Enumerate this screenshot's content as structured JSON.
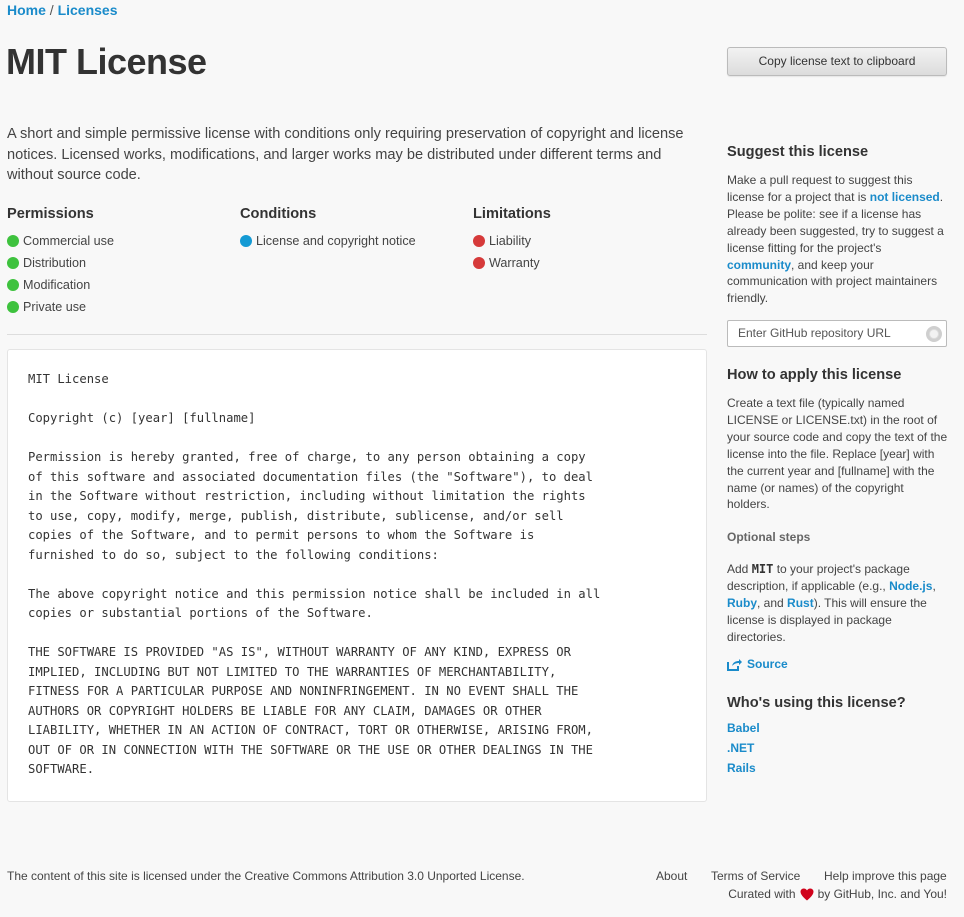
{
  "breadcrumb": {
    "home": "Home",
    "sep": "/",
    "licenses": "Licenses"
  },
  "page": {
    "title": "MIT License",
    "copy_button": "Copy license text to clipboard",
    "description": "A short and simple permissive license with conditions only requiring preservation of copyright and license notices. Licensed works, modifications, and larger works may be distributed under different terms and without source code."
  },
  "rules": {
    "permissions": {
      "heading": "Permissions",
      "items": [
        "Commercial use",
        "Distribution",
        "Modification",
        "Private use"
      ]
    },
    "conditions": {
      "heading": "Conditions",
      "items": [
        "License and copyright notice"
      ]
    },
    "limitations": {
      "heading": "Limitations",
      "items": [
        "Liability",
        "Warranty"
      ]
    }
  },
  "license_text": "MIT License\n\nCopyright (c) [year] [fullname]\n\nPermission is hereby granted, free of charge, to any person obtaining a copy\nof this software and associated documentation files (the \"Software\"), to deal\nin the Software without restriction, including without limitation the rights\nto use, copy, modify, merge, publish, distribute, sublicense, and/or sell\ncopies of the Software, and to permit persons to whom the Software is\nfurnished to do so, subject to the following conditions:\n\nThe above copyright notice and this permission notice shall be included in all\ncopies or substantial portions of the Software.\n\nTHE SOFTWARE IS PROVIDED \"AS IS\", WITHOUT WARRANTY OF ANY KIND, EXPRESS OR\nIMPLIED, INCLUDING BUT NOT LIMITED TO THE WARRANTIES OF MERCHANTABILITY,\nFITNESS FOR A PARTICULAR PURPOSE AND NONINFRINGEMENT. IN NO EVENT SHALL THE\nAUTHORS OR COPYRIGHT HOLDERS BE LIABLE FOR ANY CLAIM, DAMAGES OR OTHER\nLIABILITY, WHETHER IN AN ACTION OF CONTRACT, TORT OR OTHERWISE, ARISING FROM,\nOUT OF OR IN CONNECTION WITH THE SOFTWARE OR THE USE OR OTHER DEALINGS IN THE\nSOFTWARE.",
  "sidebar": {
    "suggest": {
      "heading": "Suggest this license",
      "text_1": "Make a pull request to suggest this license for a project that is ",
      "link_not_licensed": "not licensed",
      "text_2": ". Please be polite: see if a license has already been suggested, try to suggest a license fitting for the project's ",
      "link_community": "community",
      "text_3": ", and keep your communication with project maintainers friendly.",
      "input_placeholder": "Enter GitHub repository URL"
    },
    "apply": {
      "heading": "How to apply this license",
      "text": "Create a text file (typically named LICENSE or LICENSE.txt) in the root of your source code and copy the text of the license into the file. Replace [year] with the current year and [fullname] with the name (or names) of the copyright holders.",
      "optional_heading": "Optional steps",
      "opt_1": "Add ",
      "opt_code": "MIT",
      "opt_2": " to your project's package description, if applicable (e.g., ",
      "opt_link_node": "Node.js",
      "opt_3": ", ",
      "opt_link_ruby": "Ruby",
      "opt_4": ", and ",
      "opt_link_rust": "Rust",
      "opt_5": "). This will ensure the license is displayed in package directories.",
      "source_link": "Source"
    },
    "users": {
      "heading": "Who's using this license?",
      "items": [
        "Babel",
        ".NET",
        "Rails"
      ]
    }
  },
  "footer": {
    "license_note": "The content of this site is licensed under the Creative Commons Attribution 3.0 Unported License.",
    "about": "About",
    "terms": "Terms of Service",
    "help": "Help improve this page",
    "curated_1": "Curated with",
    "curated_2": "by GitHub, Inc. and You!"
  },
  "colors": {
    "link": "#1a8bca",
    "permission": "#3ec23e",
    "condition": "#149ad4",
    "limitation": "#d63a3a",
    "heart": "#d0021b"
  }
}
